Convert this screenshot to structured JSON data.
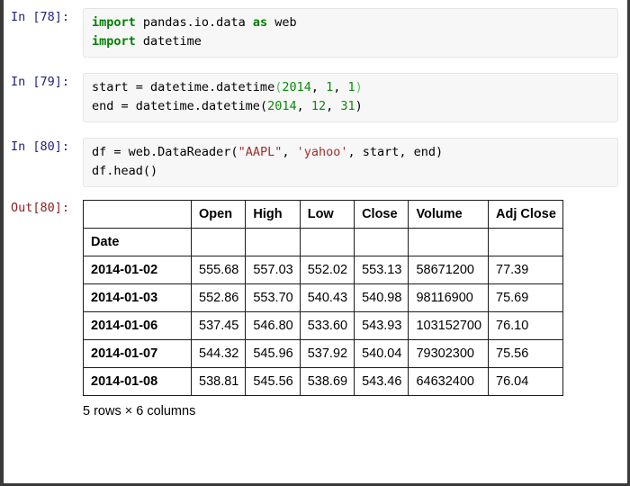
{
  "notebook": {
    "cells": [
      {
        "type": "input",
        "prompt": "In [78]:",
        "lines": [
          [
            {
              "t": "import",
              "c": "kw"
            },
            {
              "t": " pandas.io.data ",
              "c": "plain"
            },
            {
              "t": "as",
              "c": "kw"
            },
            {
              "t": " web",
              "c": "plain"
            }
          ],
          [
            {
              "t": "import",
              "c": "kw"
            },
            {
              "t": " datetime",
              "c": "plain"
            }
          ]
        ]
      },
      {
        "type": "input",
        "prompt": "In [79]:",
        "lines": [
          [
            {
              "t": "start = datetime.datetime",
              "c": "plain"
            },
            {
              "t": "(",
              "c": "pun"
            },
            {
              "t": "2014",
              "c": "num"
            },
            {
              "t": ", ",
              "c": "plain"
            },
            {
              "t": "1",
              "c": "num"
            },
            {
              "t": ", ",
              "c": "plain"
            },
            {
              "t": "1",
              "c": "num"
            },
            {
              "t": ")",
              "c": "pun"
            }
          ],
          [
            {
              "t": "end = datetime.datetime",
              "c": "plain"
            },
            {
              "t": "(",
              "c": "plain"
            },
            {
              "t": "2014",
              "c": "num"
            },
            {
              "t": ", ",
              "c": "plain"
            },
            {
              "t": "12",
              "c": "num"
            },
            {
              "t": ", ",
              "c": "plain"
            },
            {
              "t": "31",
              "c": "num"
            },
            {
              "t": ")",
              "c": "plain"
            }
          ]
        ]
      },
      {
        "type": "input",
        "prompt": "In [80]:",
        "lines": [
          [
            {
              "t": "df = web.DataReader(",
              "c": "plain"
            },
            {
              "t": "\"AAPL\"",
              "c": "str"
            },
            {
              "t": ", ",
              "c": "plain"
            },
            {
              "t": "'yahoo'",
              "c": "str"
            },
            {
              "t": ", start, end)",
              "c": "plain"
            }
          ],
          [
            {
              "t": "df.head()",
              "c": "plain"
            }
          ]
        ]
      }
    ],
    "output": {
      "prompt": "Out[80]:",
      "shape_text": "5 rows × 6 columns"
    }
  },
  "dataframe": {
    "index_name": "Date",
    "columns": [
      "Open",
      "High",
      "Low",
      "Close",
      "Volume",
      "Adj Close"
    ],
    "index": [
      "2014-01-02",
      "2014-01-03",
      "2014-01-06",
      "2014-01-07",
      "2014-01-08"
    ],
    "rows": [
      [
        "555.68",
        "557.03",
        "552.02",
        "553.13",
        "58671200",
        "77.39"
      ],
      [
        "552.86",
        "553.70",
        "540.43",
        "540.98",
        "98116900",
        "75.69"
      ],
      [
        "537.45",
        "546.80",
        "533.60",
        "543.93",
        "103152700",
        "76.10"
      ],
      [
        "544.32",
        "545.96",
        "537.92",
        "540.04",
        "79302300",
        "75.56"
      ],
      [
        "538.81",
        "545.56",
        "538.69",
        "543.46",
        "64632400",
        "76.04"
      ]
    ]
  },
  "theme": {
    "in_prompt_color": "#20237a",
    "out_prompt_color": "#8b2022",
    "keyword_color": "#008000",
    "string_color": "#a2302f",
    "number_color": "#0b8a0b",
    "code_bg": "#f7f7f7",
    "table_border": "#1c1c1c",
    "page_bg": "#ffffff"
  }
}
